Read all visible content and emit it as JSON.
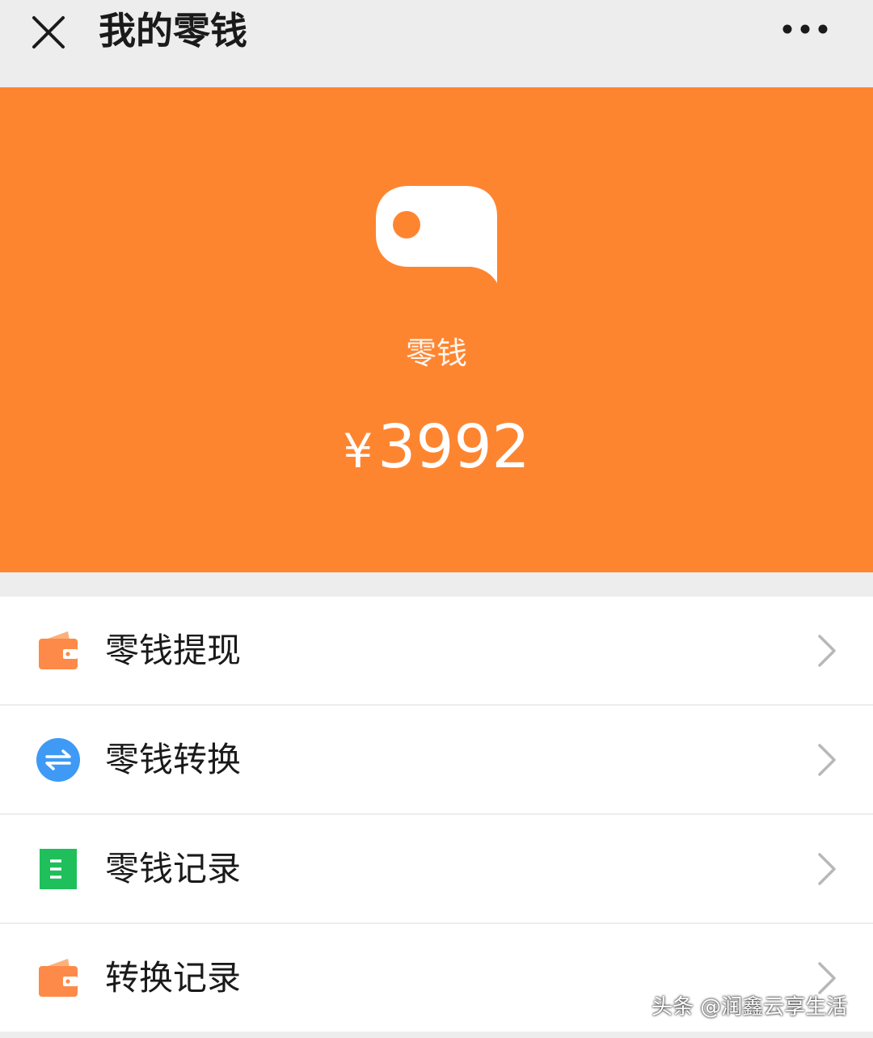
{
  "navbar": {
    "title": "我的零钱",
    "close_icon": "close-icon",
    "more_icon": "more-dots-icon"
  },
  "hero": {
    "icon": "coin-wallet-icon",
    "label": "零钱",
    "currency": "¥",
    "amount": "3992",
    "background": "#fe8530"
  },
  "menu": {
    "items": [
      {
        "label": "零钱提现",
        "icon": "wallet-icon",
        "color": "#fd8a48"
      },
      {
        "label": "零钱转换",
        "icon": "exchange-icon",
        "color": "#3e9af5"
      },
      {
        "label": "零钱记录",
        "icon": "record-list-icon",
        "color": "#1fbf5b"
      },
      {
        "label": "转换记录",
        "icon": "wallet-icon",
        "color": "#fd8a48"
      }
    ]
  },
  "watermark": "头条 @润鑫云享生活"
}
